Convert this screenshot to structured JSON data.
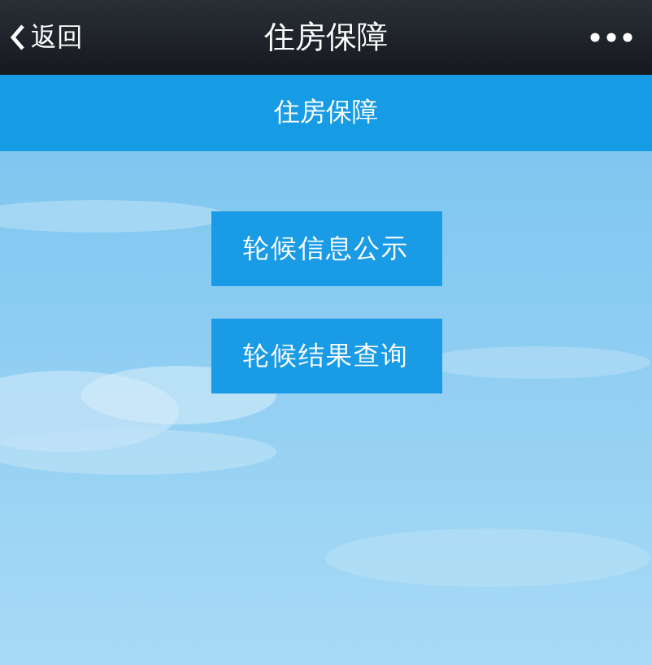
{
  "nav_bar": {
    "back_label": "返回",
    "title": "住房保障"
  },
  "header": {
    "title": "住房保障"
  },
  "buttons": [
    {
      "label": "轮候信息公示"
    },
    {
      "label": "轮候结果查询"
    }
  ]
}
